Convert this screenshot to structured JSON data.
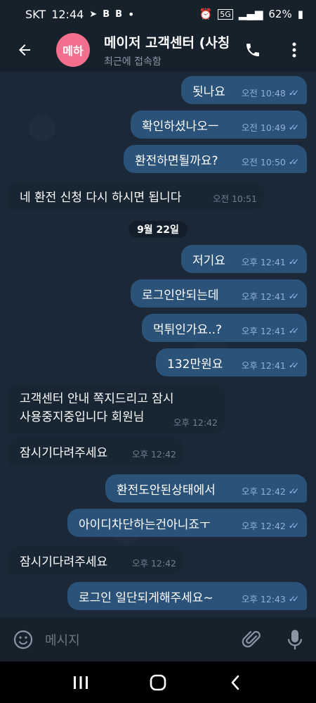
{
  "status_bar": {
    "carrier": "SKT",
    "time": "12:44",
    "battery": "62%",
    "network": "5G"
  },
  "header": {
    "avatar_text": "메하",
    "avatar_color": "#f26f8e",
    "title": "메이저 고객센터 (사칭",
    "subtitle": "최근에 접속함"
  },
  "date_separator": "9월 22일",
  "messages": [
    {
      "dir": "out",
      "text": "됫나요",
      "time": "오전 10:48",
      "read": true
    },
    {
      "dir": "out",
      "text": "확인하셨나오ㅡ",
      "time": "오전 10:49",
      "read": true
    },
    {
      "dir": "out",
      "text": "환전하면될까요?",
      "time": "오전 10:50",
      "read": true
    },
    {
      "dir": "in",
      "text": "네 환전 신청 다시 하시면 됩니다",
      "time": "오전 10:51"
    },
    {
      "dir": "out",
      "text": "저기요",
      "time": "오후 12:41",
      "read": true
    },
    {
      "dir": "out",
      "text": "로그인안되는데",
      "time": "오후 12:41",
      "read": true
    },
    {
      "dir": "out",
      "text": "먹튀인가요..?",
      "time": "오후 12:41",
      "read": true
    },
    {
      "dir": "out",
      "text": "132만원요",
      "time": "오후 12:41",
      "read": true
    },
    {
      "dir": "in",
      "line1": "고객센터 안내 쪽지드리고 잠시",
      "line2": "사용중지중입니다 회원님",
      "time": "오후 12:42"
    },
    {
      "dir": "in",
      "text": "잠시기다려주세요",
      "time": "오후 12:42"
    },
    {
      "dir": "out",
      "text": "환전도안된상태에서",
      "time": "오후 12:42",
      "read": true
    },
    {
      "dir": "out",
      "text": "아이디차단하는건아니죠ㅜ",
      "time": "오후 12:42",
      "read": true
    },
    {
      "dir": "in",
      "text": "잠시기다려주세요",
      "time": "오후 12:42"
    },
    {
      "dir": "out",
      "text": "로그인 일단되게해주세요~",
      "time": "오후 12:43",
      "read": true
    }
  ],
  "input": {
    "placeholder": "메시지"
  },
  "icons": {
    "back": "back-arrow-icon",
    "call": "phone-icon",
    "menu": "kebab-menu-icon",
    "emoji": "emoji-icon",
    "attach": "paperclip-icon",
    "mic": "microphone-icon"
  },
  "colors": {
    "outgoing_bubble": "#2b5278",
    "incoming_bubble": "#182533",
    "chat_bg": "#1b2838",
    "header_bg": "#17212b",
    "check_color": "#8ec0f0"
  }
}
